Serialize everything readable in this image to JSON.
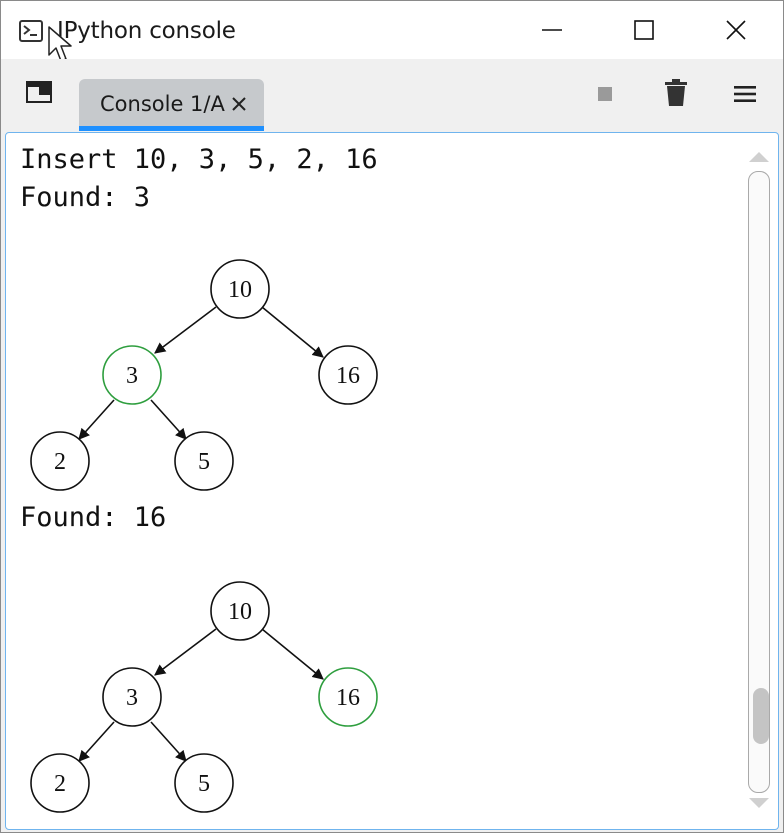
{
  "window": {
    "title": "IPython console",
    "controls": [
      "minimize-icon",
      "maximize-icon",
      "close-icon"
    ]
  },
  "toolbar": {
    "tab": {
      "label": "Console 1/A",
      "close": "×"
    },
    "icons": [
      "undock-icon",
      "stop-icon",
      "trash-icon",
      "hamburger-menu-icon"
    ]
  },
  "console": {
    "lines": {
      "insert": "Insert 10, 3, 5, 2, 16",
      "found_first": "Found: 3",
      "found_second": "Found: 16"
    },
    "trees": [
      {
        "nodes": [
          {
            "label": "10",
            "highlighted": false
          },
          {
            "label": "3",
            "highlighted": true
          },
          {
            "label": "16",
            "highlighted": false
          },
          {
            "label": "2",
            "highlighted": false
          },
          {
            "label": "5",
            "highlighted": false
          }
        ]
      },
      {
        "nodes": [
          {
            "label": "10",
            "highlighted": false
          },
          {
            "label": "3",
            "highlighted": false
          },
          {
            "label": "16",
            "highlighted": true
          },
          {
            "label": "2",
            "highlighted": false
          },
          {
            "label": "5",
            "highlighted": false
          }
        ]
      }
    ],
    "highlight_color": "#2e9e3e"
  },
  "scroll": {
    "position_fraction": 0.92
  }
}
